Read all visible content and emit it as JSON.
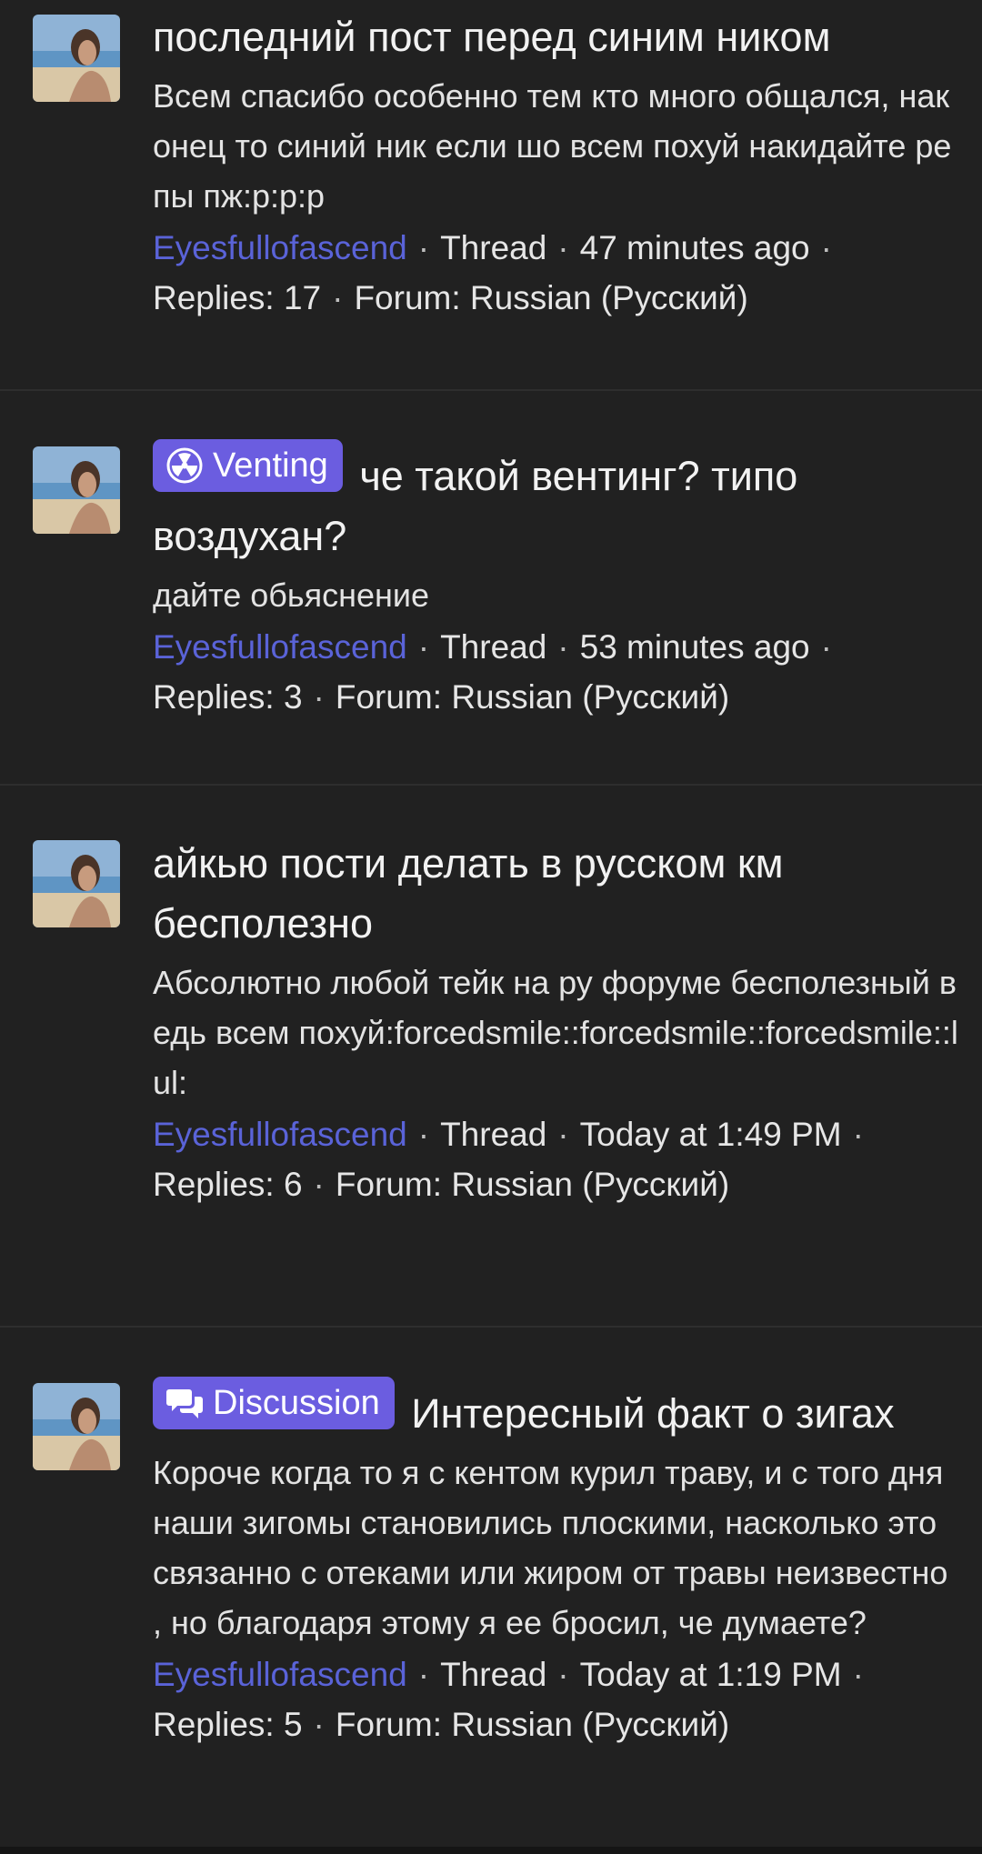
{
  "posts": [
    {
      "prefix": "",
      "title": "последний пост перед синим ником",
      "snippet": "Всем спасибо особенно тем кто много общался, наконец то синий ник если шо всем похуй накидайте репы пж:p:p:p",
      "author": "Eyesfullofascend",
      "type": "Thread",
      "time": "47 minutes ago",
      "replies": "Replies: 17",
      "forum": "Forum: Russian (Русский)"
    },
    {
      "prefix": "Venting",
      "prefix_icon": "radioactive-icon",
      "title": "че такой вентинг? типо воздухан?",
      "snippet": "дайте обьяснение",
      "author": "Eyesfullofascend",
      "type": "Thread",
      "time": "53 minutes ago",
      "replies": "Replies: 3",
      "forum": "Forum: Russian (Русский)"
    },
    {
      "prefix": "",
      "title": "айкью пости делать в русском км бесполезно",
      "snippet": "Абсолютно любой тейк на ру форуме бесполезный ведь всем похуй:forcedsmile::forcedsmile::forcedsmile::lul:",
      "author": "Eyesfullofascend",
      "type": "Thread",
      "time": "Today at 1:49 PM",
      "replies": "Replies: 6",
      "forum": "Forum: Russian (Русский)"
    },
    {
      "prefix": "Discussion",
      "prefix_icon": "chat-bubbles-icon",
      "title": "Интересный факт о зигах",
      "snippet": "Короче когда то я с кентом курил траву, и с того дня наши зигомы становились плоскими, насколько это связанно с отеками или жиром от травы неизвестно , но благодаря этому я ее бросил, че думаете?",
      "author": "Eyesfullofascend",
      "type": "Thread",
      "time": "Today at 1:19 PM",
      "replies": "Replies: 5",
      "forum": "Forum: Russian (Русский)"
    }
  ],
  "colors": {
    "background": "#212121",
    "author_link": "#5a63d8",
    "badge": "#6b5de0",
    "divider": "#2e2e2e"
  }
}
